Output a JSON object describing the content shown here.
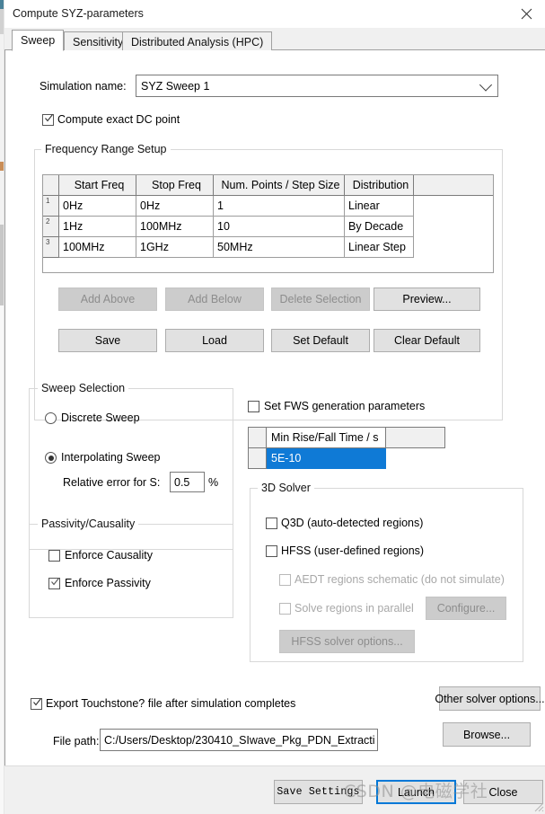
{
  "window": {
    "title": "Compute SYZ-parameters",
    "close_icon": "close-x-icon"
  },
  "tabs": [
    {
      "label": "Sweep",
      "active": true
    },
    {
      "label": "Sensitivity",
      "active": false
    },
    {
      "label": "Distributed Analysis (HPC)",
      "active": false
    }
  ],
  "simulation": {
    "label": "Simulation name:",
    "value": "SYZ Sweep 1",
    "chevron_icon": "chevron-down-icon"
  },
  "compute_dc": {
    "label": "Compute exact DC point",
    "checked": true
  },
  "frequency_group": {
    "title": "Frequency Range Setup",
    "columns": [
      "",
      "Start Freq",
      "Stop Freq",
      "Num. Points / Step Size",
      "Distribution",
      ""
    ],
    "rows": [
      {
        "index": "1",
        "start": "0Hz",
        "stop": "0Hz",
        "points": "1",
        "distribution": "Linear"
      },
      {
        "index": "2",
        "start": "1Hz",
        "stop": "100MHz",
        "points": "10",
        "distribution": "By Decade"
      },
      {
        "index": "3",
        "start": "100MHz",
        "stop": "1GHz",
        "points": "50MHz",
        "distribution": "Linear Step"
      }
    ],
    "buttons_row1": [
      {
        "label": "Add Above",
        "disabled": true
      },
      {
        "label": "Add Below",
        "disabled": true
      },
      {
        "label": "Delete Selection",
        "disabled": true
      },
      {
        "label": "Preview...",
        "disabled": false
      }
    ],
    "buttons_row2": [
      {
        "label": "Save",
        "disabled": false
      },
      {
        "label": "Load",
        "disabled": false
      },
      {
        "label": "Set Default",
        "disabled": false
      },
      {
        "label": "Clear Default",
        "disabled": false
      }
    ]
  },
  "sweep_selection": {
    "title": "Sweep Selection",
    "discrete": {
      "label": "Discrete Sweep",
      "selected": false
    },
    "interpolating": {
      "label": "Interpolating Sweep",
      "selected": true
    },
    "relative_error": {
      "label": "Relative error for S:",
      "value": "0.5",
      "unit": "%"
    }
  },
  "passivity_causality": {
    "title": "Passivity/Causality",
    "enforce_causality": {
      "label": "Enforce Causality",
      "checked": false
    },
    "enforce_passivity": {
      "label": "Enforce Passivity",
      "checked": true
    }
  },
  "fws": {
    "label": "Set FWS generation parameters",
    "checked": false,
    "table": {
      "columns": [
        "",
        "Min Rise/Fall Time / s",
        ""
      ],
      "rows": [
        {
          "index": "",
          "value": "5E-10",
          "selected": true
        }
      ]
    }
  },
  "solver_3d": {
    "title": "3D Solver",
    "q3d": {
      "label": "Q3D (auto-detected regions)",
      "checked": false,
      "disabled": false
    },
    "hfss": {
      "label": "HFSS (user-defined regions)",
      "checked": false,
      "disabled": false
    },
    "aedt_schematic": {
      "label": "AEDT regions schematic (do not simulate)",
      "checked": false,
      "disabled": true
    },
    "solve_parallel": {
      "label": "Solve regions in parallel",
      "checked": false,
      "disabled": true
    },
    "configure_button": {
      "label": "Configure...",
      "disabled": true
    },
    "hfss_options_button": {
      "label": "HFSS solver options...",
      "disabled": true
    }
  },
  "export": {
    "touchstone": {
      "label": "Export Touchstone? file after simulation completes",
      "checked": true
    },
    "file_path_label": "File path:",
    "file_path_value": "C:/Users/Desktop/230410_SIwave_Pkg_PDN_Extracti",
    "browse_button": "Browse...",
    "other_solver_options_button": "Other solver options..."
  },
  "footer": {
    "save_settings": "Save Settings",
    "launch": "Launch",
    "close": "Close"
  },
  "watermark": "CSDN @电磁学社",
  "colors": {
    "accent": "#0078d7",
    "selection": "#0f7ad6",
    "window_bg": "#ffffff",
    "panel_bg": "#f0f0f0",
    "button_bg": "#e1e1e1"
  }
}
